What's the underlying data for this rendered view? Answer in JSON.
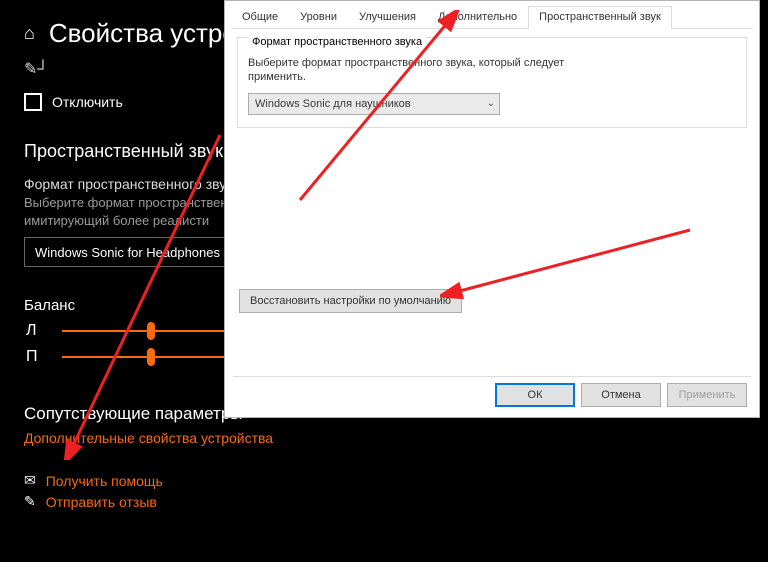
{
  "settings": {
    "title": "Свойства устрой",
    "pin_label": "",
    "disable_label": "Отключить",
    "spatial": {
      "title": "Пространственный звук",
      "sub": "Формат пространственного звука",
      "desc": "Выберите формат пространственно­ звук, имитирующий более реалисти",
      "dd_value": "Windows Sonic for Headphones"
    },
    "balance": {
      "title": "Баланс",
      "left_label": "Л",
      "right_label": "П"
    },
    "related": {
      "title": "Сопутствующие параметры",
      "link": "Дополнительные свойства устройства"
    },
    "footer": {
      "help": "Получить помощь",
      "feedback": "Отправить отзыв"
    }
  },
  "dialog": {
    "tabs": [
      "Общие",
      "Уровни",
      "Улучшения",
      "Дополнительно",
      "Пространственный звук"
    ],
    "active_tab": "Пространственный звук",
    "panel_title": "Формат пространственного звука",
    "panel_desc": "Выберите формат пространственного звука, который следует применить.",
    "combo_value": "Windows Sonic для наушников",
    "restore": "Восстановить настройки по умолчанию",
    "ok": "ОК",
    "cancel": "Отмена",
    "apply": "Применить"
  }
}
